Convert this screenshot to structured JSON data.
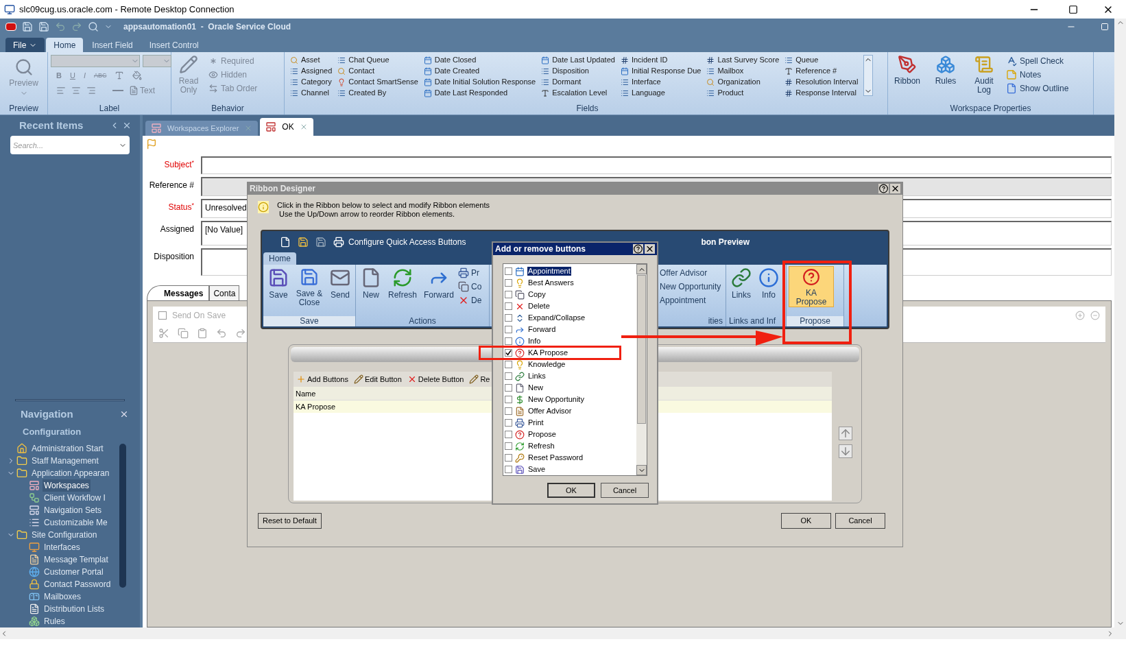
{
  "window": {
    "title": "slc09cug.us.oracle.com - Remote Desktop Connection"
  },
  "app": {
    "title": "appsautomation01  -  Oracle Service Cloud"
  },
  "ribbon_tabs": [
    {
      "label": "File",
      "kind": "menu",
      "selected": false
    },
    {
      "label": "Home",
      "kind": "tab",
      "selected": true
    },
    {
      "label": "Insert Field",
      "kind": "tab",
      "selected": false
    },
    {
      "label": "Insert Control",
      "kind": "tab",
      "selected": false
    }
  ],
  "ribbon": {
    "preview": {
      "button": "Preview",
      "group": "Preview",
      "disabled": true
    },
    "label_group": {
      "group": "Label",
      "format_buttons": [
        "B",
        "U",
        "I",
        "ABC"
      ],
      "text_button": "Text",
      "disabled": true
    },
    "behavior": {
      "group": "Behavior",
      "read_only": "Read Only",
      "items": [
        "Required",
        "Hidden",
        "Tab Order"
      ],
      "disabled": true
    },
    "fields": {
      "group": "Fields",
      "columns": [
        [
          {
            "label": "Asset",
            "kind": "lookup"
          },
          {
            "label": "Assigned",
            "kind": "list"
          },
          {
            "label": "Category",
            "kind": "list"
          },
          {
            "label": "Channel",
            "kind": "list"
          }
        ],
        [
          {
            "label": "Chat Queue",
            "kind": "list"
          },
          {
            "label": "Contact",
            "kind": "lookup"
          },
          {
            "label": "Contact SmartSense",
            "kind": "smartsense"
          },
          {
            "label": "Created By",
            "kind": "list"
          }
        ],
        [
          {
            "label": "Date Closed",
            "kind": "date"
          },
          {
            "label": "Date Created",
            "kind": "date"
          },
          {
            "label": "Date Initial Solution Response",
            "kind": "date"
          },
          {
            "label": "Date Last Responded",
            "kind": "date"
          }
        ],
        [
          {
            "label": "Date Last Updated",
            "kind": "date"
          },
          {
            "label": "Disposition",
            "kind": "list"
          },
          {
            "label": "Dormant",
            "kind": "list"
          },
          {
            "label": "Escalation Level",
            "kind": "text"
          }
        ],
        [
          {
            "label": "Incident ID",
            "kind": "number"
          },
          {
            "label": "Initial Response Due",
            "kind": "date"
          },
          {
            "label": "Interface",
            "kind": "list"
          },
          {
            "label": "Language",
            "kind": "list"
          }
        ],
        [
          {
            "label": "Last Survey Score",
            "kind": "number"
          },
          {
            "label": "Mailbox",
            "kind": "list"
          },
          {
            "label": "Organization",
            "kind": "lookup"
          },
          {
            "label": "Product",
            "kind": "list"
          }
        ],
        [
          {
            "label": "Queue",
            "kind": "list"
          },
          {
            "label": "Reference #",
            "kind": "text"
          },
          {
            "label": "Resolution Interval",
            "kind": "number"
          },
          {
            "label": "Response Interval",
            "kind": "number"
          }
        ]
      ]
    },
    "workspace": {
      "group": "Workspace Properties",
      "large": [
        {
          "label": "Ribbon",
          "kind": "ribbon"
        },
        {
          "label": "Rules",
          "kind": "rules"
        },
        {
          "label": "Audit Log",
          "kind": "log"
        }
      ],
      "small": [
        {
          "label": "Spell Check",
          "kind": "spell"
        },
        {
          "label": "Notes",
          "kind": "notes"
        },
        {
          "label": "Show Outline",
          "kind": "outline"
        }
      ]
    }
  },
  "recent": {
    "title": "Recent Items",
    "search_placeholder": "Search..."
  },
  "navigation": {
    "title": "Navigation",
    "section": "Configuration",
    "tree": [
      {
        "label": "Administration Start",
        "kind": "home",
        "selected": false
      },
      {
        "label": "Staff Management",
        "kind": "folder",
        "expanded": false,
        "selected": false
      },
      {
        "label": "Application Appearan",
        "kind": "folder",
        "expanded": true,
        "selected": false,
        "children": [
          {
            "label": "Workspaces",
            "kind": "workspace",
            "selected": true
          },
          {
            "label": "Client Workflow I",
            "kind": "workflow",
            "selected": false
          },
          {
            "label": "Navigation Sets",
            "kind": "navset",
            "selected": false
          },
          {
            "label": "Customizable Me",
            "kind": "menu",
            "selected": false
          }
        ]
      },
      {
        "label": "Site Configuration",
        "kind": "folder",
        "expanded": true,
        "selected": false,
        "children": [
          {
            "label": "Interfaces",
            "kind": "interface",
            "selected": false
          },
          {
            "label": "Message Templat",
            "kind": "template",
            "selected": false
          },
          {
            "label": "Customer Portal",
            "kind": "portal",
            "selected": false
          },
          {
            "label": "Contact Password",
            "kind": "lock",
            "selected": false
          },
          {
            "label": "Mailboxes",
            "kind": "mailbox",
            "selected": false
          },
          {
            "label": "Distribution Lists",
            "kind": "list",
            "selected": false
          },
          {
            "label": "Rules",
            "kind": "rules",
            "selected": false
          }
        ]
      }
    ]
  },
  "content_tabs": [
    {
      "label": "Workspaces Explorer",
      "selected": false
    },
    {
      "label": "OK",
      "selected": true
    }
  ],
  "form": {
    "fields": [
      {
        "label": "Subject$^{*}$",
        "required": true,
        "disabled": false
      },
      {
        "label": "Reference #",
        "required": false,
        "disabled": true
      },
      {
        "label": "Status$^{*}$",
        "required": true,
        "disabled": false,
        "value": "Unresolved"
      },
      {
        "label": "Assigned",
        "required": false,
        "disabled": false,
        "value": "[No Value]"
      },
      {
        "label": "Disposition",
        "required": false,
        "disabled": false
      }
    ]
  },
  "messages": {
    "tabs": [
      {
        "label": "Messages",
        "selected": true
      },
      {
        "label": "Conta",
        "selected": false
      }
    ],
    "send_on_save": {
      "label": "Send On Save",
      "checked": false,
      "disabled": true
    }
  },
  "ribbon_designer": {
    "title": "Ribbon Designer",
    "info": [
      "Click in the Ribbon below to select and modify Ribbon elements",
      "Use the Up/Down arrow to reorder Ribbon elements."
    ],
    "preview": {
      "quick_access_label": "Configure Quick Access Buttons",
      "title": "bon Preview",
      "tab": "Home",
      "groups": [
        {
          "label": "Save",
          "large": [
            {
              "label": "Save",
              "kind": "save",
              "selected": false
            },
            {
              "label": "Save & Close",
              "kind": "save-close",
              "selected": false
            },
            {
              "label": "Send",
              "kind": "send",
              "selected": false
            }
          ]
        },
        {
          "label": "Actions",
          "large": [
            {
              "label": "New",
              "kind": "new",
              "selected": false
            },
            {
              "label": "Refresh",
              "kind": "refresh",
              "selected": false
            },
            {
              "label": "Forward",
              "kind": "forward",
              "selected": false
            }
          ],
          "small": [
            {
              "label": "Pr",
              "kind": "print",
              "selected": false
            },
            {
              "label": "Co",
              "kind": "copy",
              "selected": false
            },
            {
              "label": "De",
              "kind": "delete",
              "selected": false
            }
          ]
        },
        {
          "label": "ities",
          "small": [
            {
              "label": "Offer Advisor",
              "kind": "none",
              "selected": false
            },
            {
              "label": "New Opportunity",
              "kind": "none",
              "selected": false
            },
            {
              "label": "Appointment",
              "kind": "none",
              "selected": false
            }
          ]
        },
        {
          "label": "Links and Inf",
          "large": [
            {
              "label": "Links",
              "kind": "links",
              "selected": false
            },
            {
              "label": "Info",
              "kind": "info",
              "selected": false
            }
          ]
        },
        {
          "label": "Propose",
          "large": [
            {
              "label": "KA Propose",
              "kind": "propose",
              "selected": true
            }
          ]
        }
      ]
    },
    "toolbar": [
      {
        "label": "Add Buttons",
        "kind": "add"
      },
      {
        "label": "Edit Button",
        "kind": "edit"
      },
      {
        "label": "Delete Button",
        "kind": "delete"
      },
      {
        "label": "Re",
        "kind": "rename"
      }
    ],
    "table": {
      "columns": [
        "Name"
      ],
      "rows": [
        {
          "name": "KA Propose",
          "selected": true
        }
      ]
    },
    "buttons": {
      "reset": "Reset to Default",
      "ok": "OK",
      "cancel": "Cancel"
    }
  },
  "add_remove": {
    "title": "Add or remove buttons",
    "items": [
      {
        "label": "Appointment",
        "kind": "appointment",
        "checked": false,
        "selected": true
      },
      {
        "label": "Best Answers",
        "kind": "answers",
        "checked": false,
        "selected": false
      },
      {
        "label": "Copy",
        "kind": "copy",
        "checked": false,
        "selected": false
      },
      {
        "label": "Delete",
        "kind": "delete",
        "checked": false,
        "selected": false
      },
      {
        "label": "Expand/Collapse",
        "kind": "expand",
        "checked": false,
        "selected": false
      },
      {
        "label": "Forward",
        "kind": "forward",
        "checked": false,
        "selected": false
      },
      {
        "label": "Info",
        "kind": "info",
        "checked": false,
        "selected": false
      },
      {
        "label": "KA Propose",
        "kind": "propose",
        "checked": true,
        "selected": false
      },
      {
        "label": "Knowledge",
        "kind": "knowledge",
        "checked": false,
        "selected": false
      },
      {
        "label": "Links",
        "kind": "links",
        "checked": false,
        "selected": false
      },
      {
        "label": "New",
        "kind": "new",
        "checked": false,
        "selected": false
      },
      {
        "label": "New Opportunity",
        "kind": "opportunity",
        "checked": false,
        "selected": false
      },
      {
        "label": "Offer Advisor",
        "kind": "advisor",
        "checked": false,
        "selected": false
      },
      {
        "label": "Print",
        "kind": "print",
        "checked": false,
        "selected": false
      },
      {
        "label": "Propose",
        "kind": "propose",
        "checked": false,
        "selected": false
      },
      {
        "label": "Refresh",
        "kind": "refresh",
        "checked": false,
        "selected": false
      },
      {
        "label": "Reset Password",
        "kind": "password",
        "checked": false,
        "selected": false
      },
      {
        "label": "Save",
        "kind": "save",
        "checked": false,
        "selected": false
      }
    ],
    "buttons": {
      "ok": "OK",
      "cancel": "Cancel"
    }
  }
}
